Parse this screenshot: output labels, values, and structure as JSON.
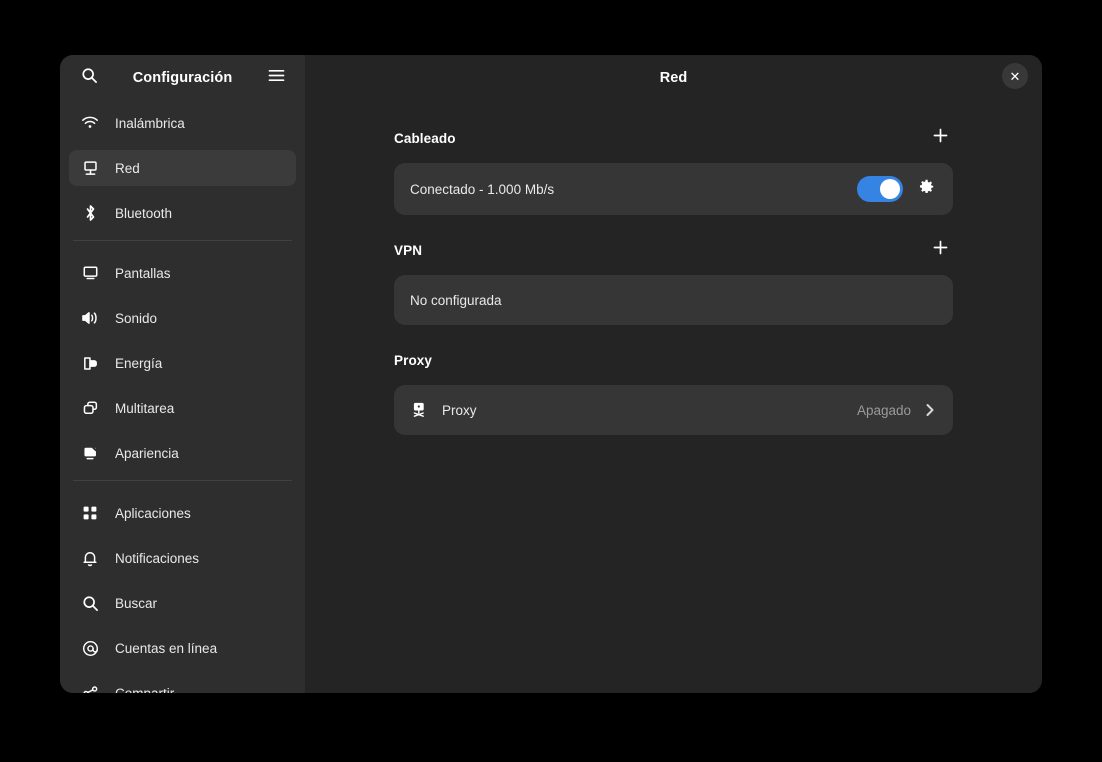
{
  "window": {
    "app_title": "Configuración",
    "page_title": "Red",
    "search_icon": "search-icon",
    "menu_icon": "hamburger-menu-icon",
    "close_icon": "close-icon",
    "close_label": "✕"
  },
  "sidebar": {
    "groups": [
      {
        "items": [
          {
            "label": "Inalámbrica",
            "icon": "wifi-icon",
            "selected": false
          },
          {
            "label": "Red",
            "icon": "network-wired-icon",
            "selected": true
          },
          {
            "label": "Bluetooth",
            "icon": "bluetooth-icon",
            "selected": false
          }
        ]
      },
      {
        "items": [
          {
            "label": "Pantallas",
            "icon": "display-icon",
            "selected": false
          },
          {
            "label": "Sonido",
            "icon": "sound-icon",
            "selected": false
          },
          {
            "label": "Energía",
            "icon": "power-icon",
            "selected": false
          },
          {
            "label": "Multitarea",
            "icon": "multitasking-icon",
            "selected": false
          },
          {
            "label": "Apariencia",
            "icon": "appearance-icon",
            "selected": false
          }
        ]
      },
      {
        "items": [
          {
            "label": "Aplicaciones",
            "icon": "applications-icon",
            "selected": false
          },
          {
            "label": "Notificaciones",
            "icon": "bell-icon",
            "selected": false
          },
          {
            "label": "Buscar",
            "icon": "search-icon",
            "selected": false
          },
          {
            "label": "Cuentas en línea",
            "icon": "at-sign-icon",
            "selected": false
          },
          {
            "label": "Compartir",
            "icon": "share-icon",
            "selected": false
          }
        ]
      }
    ]
  },
  "main": {
    "sections": {
      "wired": {
        "title": "Cableado",
        "add_label": "+",
        "row": {
          "label": "Conectado - 1.000 Mb/s",
          "toggle_on": true,
          "settings_icon": "gear-icon"
        }
      },
      "vpn": {
        "title": "VPN",
        "add_label": "+",
        "row": {
          "label": "No configurada"
        }
      },
      "proxy": {
        "title": "Proxy",
        "row": {
          "icon": "proxy-icon",
          "label": "Proxy",
          "status": "Apagado",
          "chevron_icon": "chevron-right-icon"
        }
      }
    }
  },
  "colors": {
    "accent": "#3584e4",
    "window_bg": "#242424",
    "sidebar_bg": "#2e2e2e",
    "card_bg": "#363636",
    "selected_bg": "#3b3b3b",
    "desktop_bg": "#000000"
  }
}
